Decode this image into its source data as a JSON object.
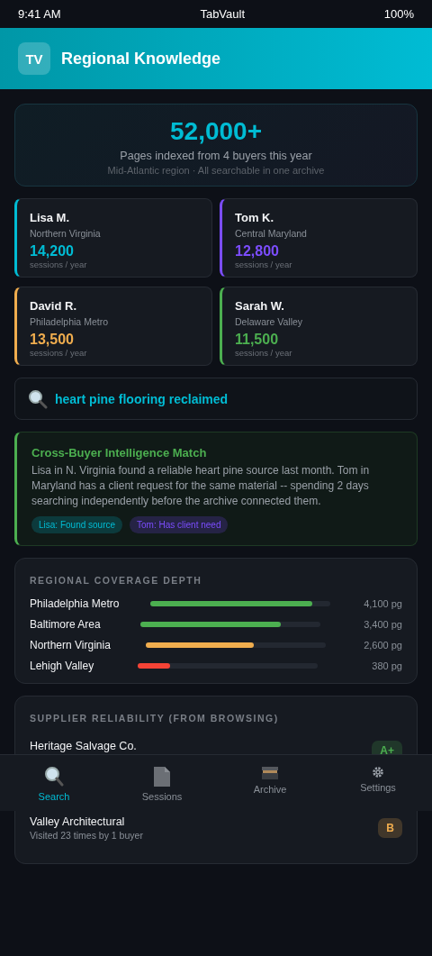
{
  "status_bar": {
    "time": "9:41 AM",
    "app": "TabVault",
    "battery": "100%"
  },
  "header": {
    "logo": "TV",
    "title": "Regional Knowledge"
  },
  "summary": {
    "value": "52,000+",
    "caption": "Pages indexed from 4 buyers this year",
    "note": "Mid-Atlantic region · All searchable in one archive"
  },
  "buyers": [
    {
      "name": "Lisa M.",
      "region": "Northern Virginia",
      "sessions": "14,200",
      "unit": "sessions / year",
      "color": "#00bcd4"
    },
    {
      "name": "Tom K.",
      "region": "Central Maryland",
      "sessions": "12,800",
      "unit": "sessions / year",
      "color": "#7c4dff"
    },
    {
      "name": "David R.",
      "region": "Philadelphia Metro",
      "sessions": "13,500",
      "unit": "sessions / year",
      "color": "#f0ad4e"
    },
    {
      "name": "Sarah W.",
      "region": "Delaware Valley",
      "sessions": "11,500",
      "unit": "sessions / year",
      "color": "#4caf50"
    }
  ],
  "search": {
    "value": "heart pine flooring reclaimed"
  },
  "match": {
    "title": "Cross-Buyer Intelligence Match",
    "body": "Lisa in N. Virginia found a reliable heart pine source last month. Tom in Maryland has a client request for the same material -- spending 2 days searching independently before the archive connected them.",
    "tags": [
      {
        "label": "Lisa: Found source",
        "kind": "found"
      },
      {
        "label": "Tom: Has client need",
        "kind": "need"
      }
    ]
  },
  "coverage": {
    "title": "REGIONAL COVERAGE DEPTH",
    "regions": [
      {
        "name": "Philadelphia Metro",
        "level": 0.9,
        "pages": "4,100 pg",
        "color": "#4caf50"
      },
      {
        "name": "Baltimore Area",
        "level": 0.78,
        "pages": "3,400 pg",
        "color": "#4caf50"
      },
      {
        "name": "Northern Virginia",
        "level": 0.6,
        "pages": "2,600 pg",
        "color": "#f0ad4e"
      },
      {
        "name": "Lehigh Valley",
        "level": 0.18,
        "pages": "380 pg",
        "color": "#f44336"
      }
    ]
  },
  "suppliers": {
    "title": "SUPPLIER RELIABILITY (FROM BROWSING)",
    "items": [
      {
        "name": "Heritage Salvage Co.",
        "grade": "A+",
        "kind": "high"
      },
      {
        "name": "Valley Architectural",
        "visits": "Visited 23 times by 1 buyer",
        "grade": "B",
        "kind": "medium"
      }
    ]
  },
  "nav": [
    {
      "label": "Search",
      "kind": "search",
      "selected": true
    },
    {
      "label": "Sessions",
      "kind": "document",
      "selected": false
    },
    {
      "label": "Archive",
      "kind": "box",
      "selected": false
    },
    {
      "label": "Settings",
      "kind": "gear",
      "selected": false
    }
  ]
}
